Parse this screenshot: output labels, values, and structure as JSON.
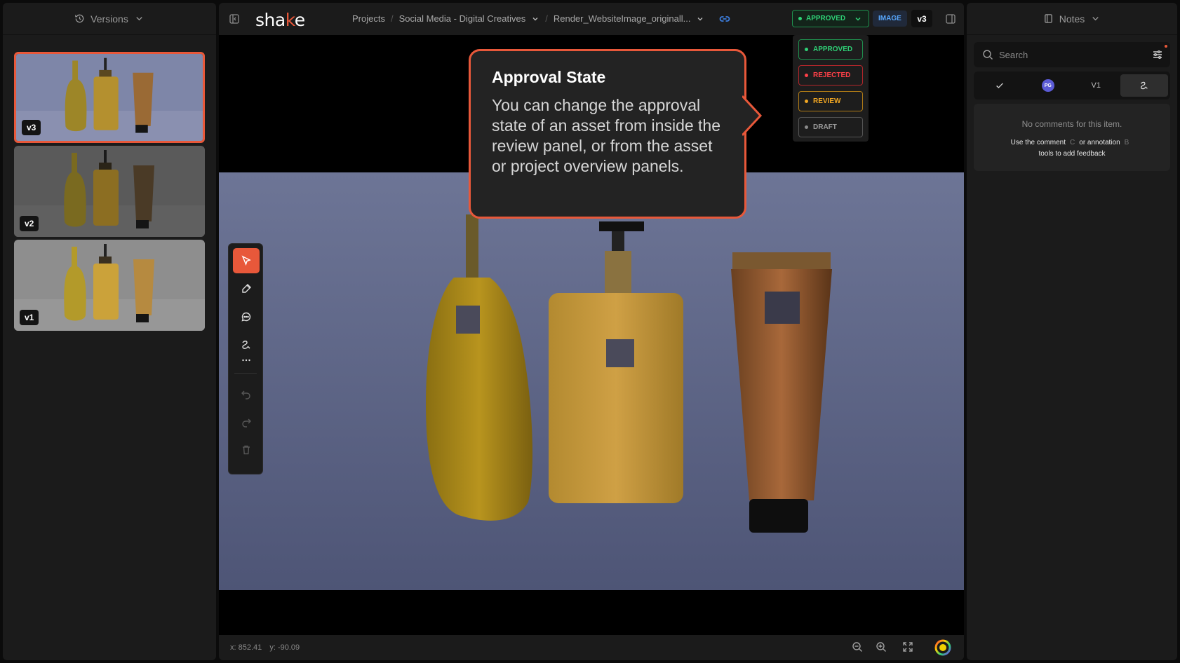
{
  "versions_panel": {
    "title": "Versions",
    "items": [
      {
        "label": "v3",
        "active": true
      },
      {
        "label": "v2",
        "active": false
      },
      {
        "label": "v1",
        "active": false
      }
    ]
  },
  "header": {
    "logo_prefix": "sha",
    "logo_accent": "k",
    "logo_suffix": "e",
    "breadcrumb": [
      "Projects",
      "Social Media - Digital Creatives",
      "Render_WebsiteImage_originall..."
    ],
    "status": "APPROVED",
    "asset_type": "IMAGE",
    "version": "v3"
  },
  "status_options": [
    {
      "label": "APPROVED",
      "color": "#2fd176"
    },
    {
      "label": "REJECTED",
      "color": "#ff4048"
    },
    {
      "label": "REVIEW",
      "color": "#f0a623"
    },
    {
      "label": "DRAFT",
      "color": "#8a8a8a"
    }
  ],
  "callout": {
    "title": "Approval State",
    "body": "You can change the approval state of an asset from inside the review panel, or from the asset or project overview panels."
  },
  "toolbar": {
    "tools": [
      "pointer-icon",
      "pen-icon",
      "comment-icon",
      "annotation-icon",
      "more-icon",
      "undo-icon",
      "redo-icon",
      "trash-icon"
    ]
  },
  "bottombar": {
    "x": "x: 852.41",
    "y": "y: -90.09"
  },
  "notes_panel": {
    "title": "Notes",
    "search_placeholder": "Search",
    "tabs": [
      {
        "label": "",
        "icon": "check-icon"
      },
      {
        "label": "PG",
        "icon": "avatar"
      },
      {
        "label": "V1",
        "icon": ""
      },
      {
        "label": "",
        "icon": "annotation-icon",
        "active": true
      }
    ],
    "empty_title": "No comments for this item.",
    "hint_prefix": "Use the comment",
    "hint_key_c": "C",
    "hint_mid": "or annotation",
    "hint_key_b": "B",
    "hint_suffix": "tools to add feedback"
  },
  "colors": {
    "accent": "#e8583a",
    "approved": "#2fd176",
    "rejected": "#ff4048",
    "review": "#f0a623",
    "link": "#3d7fe0"
  }
}
